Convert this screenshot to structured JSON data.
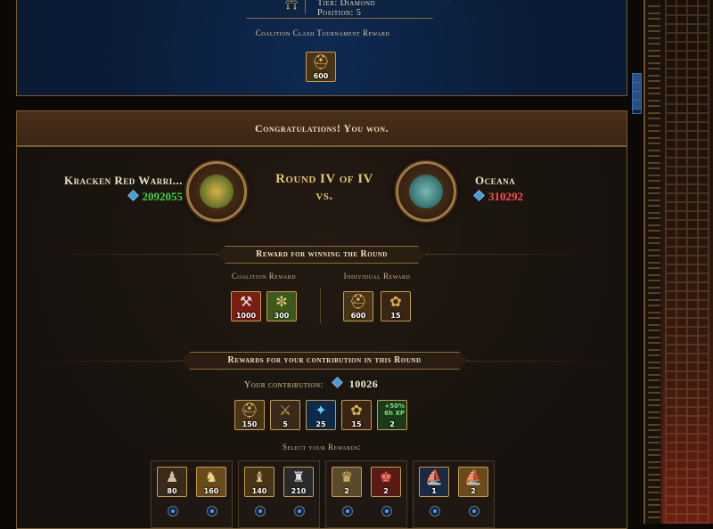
{
  "top_panel": {
    "tier_label": "Tier: Diamond",
    "position_label": "Position: 5",
    "reward_title": "Coalition Clash Tournament Reward",
    "reward": {
      "icon": "golden-helmet-icon",
      "amount": "600"
    }
  },
  "main": {
    "congrats": "Congratulations! You won.",
    "left_team": {
      "name": "Kracken Red Warri...",
      "score": "2092055",
      "score_color": "#3fd14a"
    },
    "right_team": {
      "name": "Oceana",
      "score": "310292",
      "score_color": "#ff4d4d"
    },
    "round_text": "Round IV of IV",
    "vs_text": "vs.",
    "round_reward_ribbon": "Reward for winning the Round",
    "coalition_reward_label": "Coalition Reward",
    "individual_reward_label": "Individual Reward",
    "coalition_rewards": [
      {
        "icon": "hammer-axe-icon",
        "amount": "1000"
      },
      {
        "icon": "owl-emblem-icon",
        "amount": "300"
      }
    ],
    "individual_rewards": [
      {
        "icon": "golden-helmet-icon",
        "amount": "600"
      },
      {
        "icon": "laurel-wreath-icon",
        "amount": "15"
      }
    ],
    "contribution_ribbon": "Rewards for your contribution in this Round",
    "contribution_label": "Your contribution:",
    "contribution_value": "10026",
    "contribution_rewards": [
      {
        "icon": "golden-helmet-icon",
        "amount": "150"
      },
      {
        "icon": "warrior-icon",
        "amount": "5"
      },
      {
        "icon": "blue-crystal-icon",
        "amount": "25"
      },
      {
        "icon": "laurel-wreath-icon",
        "amount": "15"
      },
      {
        "icon": "xp-boost-icon",
        "amount": "2",
        "badge": "+50% 6h XP"
      }
    ],
    "select_label": "Select your Rewards:",
    "select_groups": [
      {
        "items": [
          {
            "icon": "spearman-icon",
            "amount": "80"
          },
          {
            "icon": "archer-icon",
            "amount": "160"
          }
        ]
      },
      {
        "items": [
          {
            "icon": "swordsman-icon",
            "amount": "140"
          },
          {
            "icon": "hoplite-icon",
            "amount": "210"
          }
        ]
      },
      {
        "items": [
          {
            "icon": "spartan-icon",
            "amount": "2"
          },
          {
            "icon": "red-crest-warrior-icon",
            "amount": "2"
          }
        ]
      },
      {
        "items": [
          {
            "icon": "ship-icon",
            "amount": "1"
          },
          {
            "icon": "galley-icon",
            "amount": "2"
          }
        ]
      }
    ]
  },
  "colors": {
    "accent_gold": "#c29a4e",
    "panel_blue": "#0b1e3b",
    "win_green": "#3fd14a",
    "lose_red": "#ff4d4d"
  }
}
